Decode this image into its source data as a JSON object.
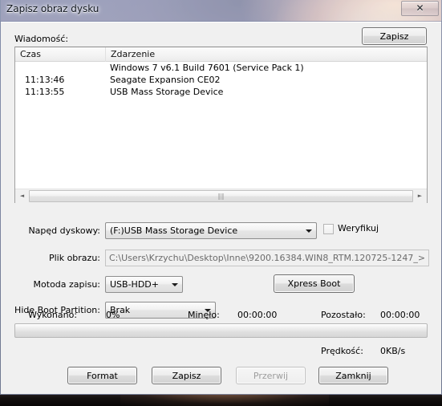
{
  "window": {
    "title": "Zapisz obraz dysku",
    "close_label": "✕"
  },
  "message_section": {
    "label": "Wiadomość:",
    "save_button": "Zapisz",
    "columns": [
      "Czas",
      "Zdarzenie"
    ],
    "rows": [
      {
        "time": "",
        "event": "Windows 7 v6.1 Build 7601 (Service Pack 1)"
      },
      {
        "time": "11:13:46",
        "event": "Seagate Expansion       CE02"
      },
      {
        "time": "11:13:55",
        "event": "USB Mass Storage Device"
      }
    ],
    "scroll_left_icon": "◄",
    "scroll_right_icon": "►",
    "scroll_grip": "‖‖"
  },
  "form": {
    "drive_label": "Napęd dyskowy:",
    "drive_value": "(F:)USB Mass Storage Device",
    "verify_label": "Weryfikuj",
    "verify_checked": false,
    "image_file_label": "Plik obrazu:",
    "image_file_value": "C:\\Users\\Krzychu\\Desktop\\Inne\\9200.16384.WIN8_RTM.120725-1247_>",
    "write_method_label": "Motoda zapisu:",
    "write_method_value": "USB-HDD+",
    "hide_partition_label": "Hide Boot Partition:",
    "hide_partition_value": "Brak",
    "xpress_boot_button": "Xpress Boot"
  },
  "status": {
    "done_label": "Wykonano:",
    "done_value": "0%",
    "elapsed_label": "Minęło:",
    "elapsed_value": "00:00:00",
    "remaining_label": "Pozostało:",
    "remaining_value": "00:00:00",
    "speed_label": "Prędkość:",
    "speed_value": "0KB/s",
    "progress_percent": 0
  },
  "buttons": {
    "format": "Format",
    "write": "Zapisz",
    "abort": "Przerwij",
    "close": "Zamknij"
  },
  "colors": {
    "dialog_face": "#f0f0f0",
    "list_background": "#ffffff",
    "accent_border": "#8e8e8e"
  }
}
